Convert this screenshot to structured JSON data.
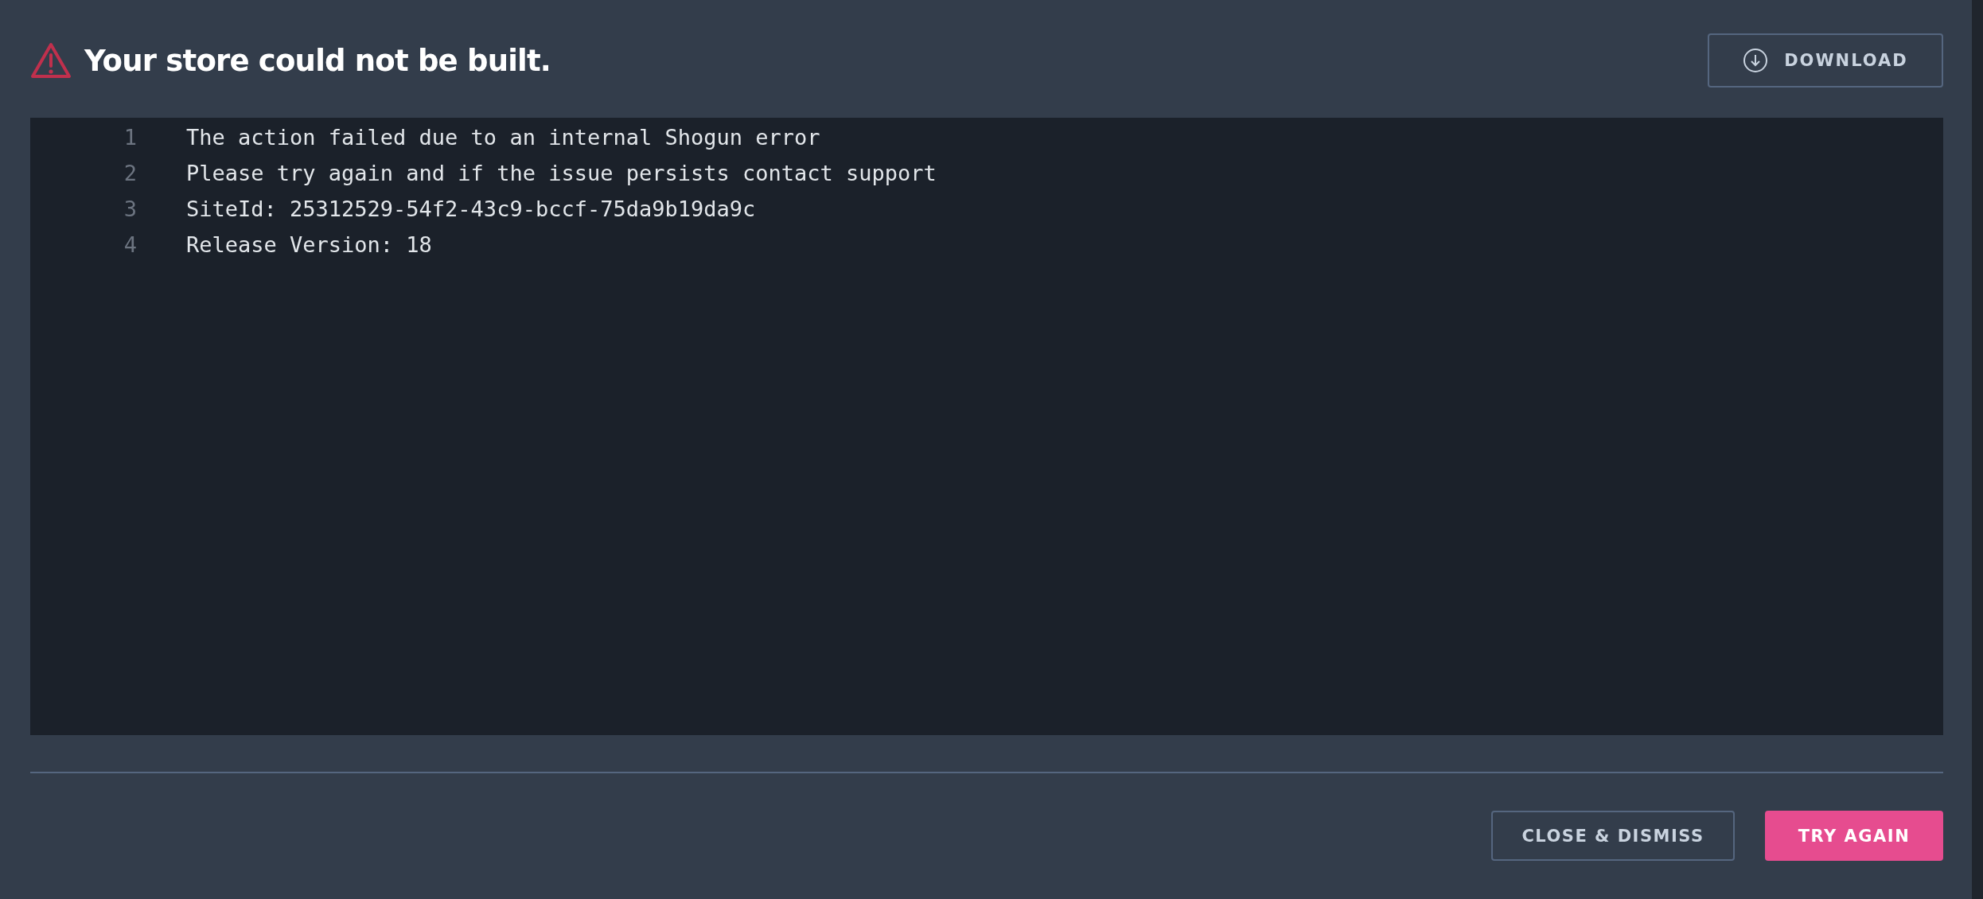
{
  "dialog": {
    "title": "Your store could not be built.",
    "download_button": "DOWNLOAD",
    "log_lines": [
      {
        "number": "1",
        "text": "The action failed due to an internal Shogun error"
      },
      {
        "number": "2",
        "text": "Please try again and if the issue persists contact support"
      },
      {
        "number": "3",
        "text": "SiteId: 25312529-54f2-43c9-bccf-75da9b19da9c"
      },
      {
        "number": "4",
        "text": "Release Version: 18"
      }
    ],
    "buttons": [
      {
        "label": "CLOSE & DISMISS",
        "kind": "secondary"
      },
      {
        "label": "TRY AGAIN",
        "kind": "primary"
      }
    ]
  }
}
